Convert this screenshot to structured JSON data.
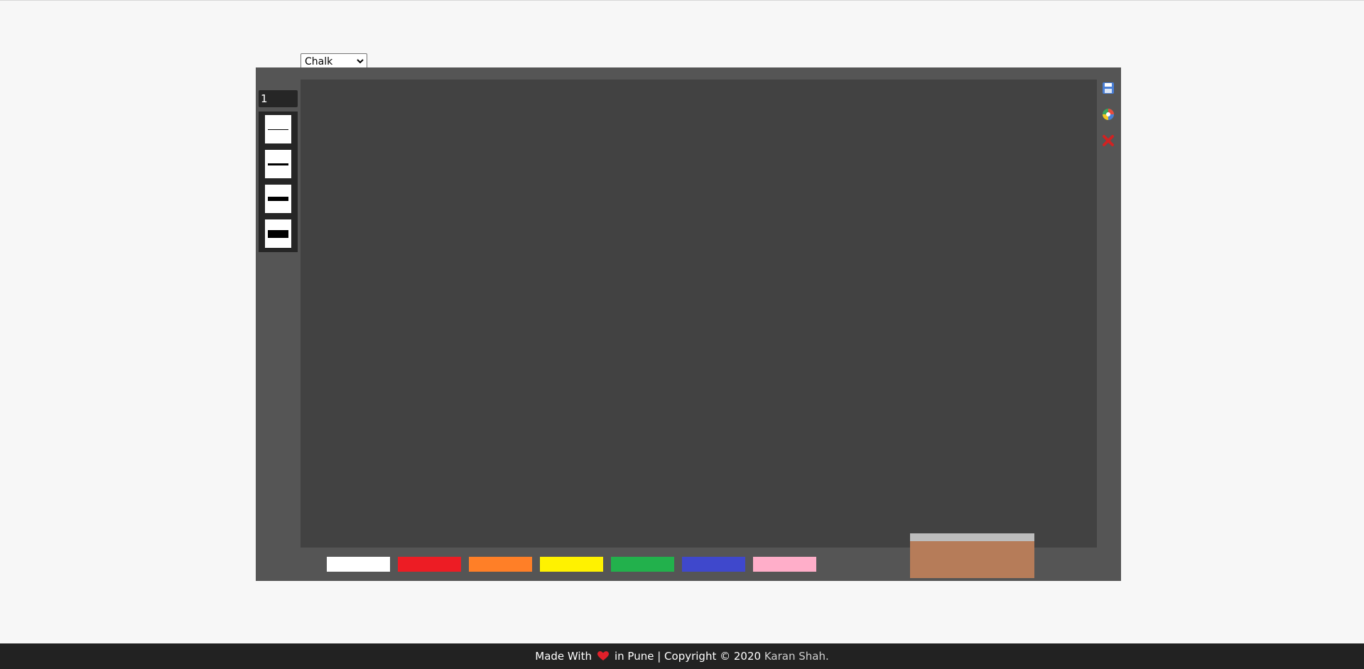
{
  "toolbar": {
    "tool_select_value": "Chalk",
    "size_input_value": "1"
  },
  "line_sizes": [
    {
      "name": "line-size-1",
      "thickness": 1
    },
    {
      "name": "line-size-2",
      "thickness": 3
    },
    {
      "name": "line-size-3",
      "thickness": 6
    },
    {
      "name": "line-size-4",
      "thickness": 11
    }
  ],
  "right_tools": [
    {
      "icon": "save-icon",
      "color": "#4a7fd6"
    },
    {
      "icon": "color-wheel-icon",
      "color": "#e84c3d"
    },
    {
      "icon": "close-icon",
      "color": "#d12222"
    }
  ],
  "colors": {
    "chalk": [
      "#ffffff",
      "#ed1c24",
      "#ff7f27",
      "#fff200",
      "#22b14c",
      "#3f48cc",
      "#ffaec9"
    ],
    "board_bg": "#424242",
    "board_frame": "#555555",
    "eraser_felt": "#bdbdbd",
    "eraser_wood": "#b67c59"
  },
  "footer": {
    "made_with": "Made With",
    "in_pune": "in Pune | Copyright © 2020",
    "author": "Karan Shah."
  }
}
